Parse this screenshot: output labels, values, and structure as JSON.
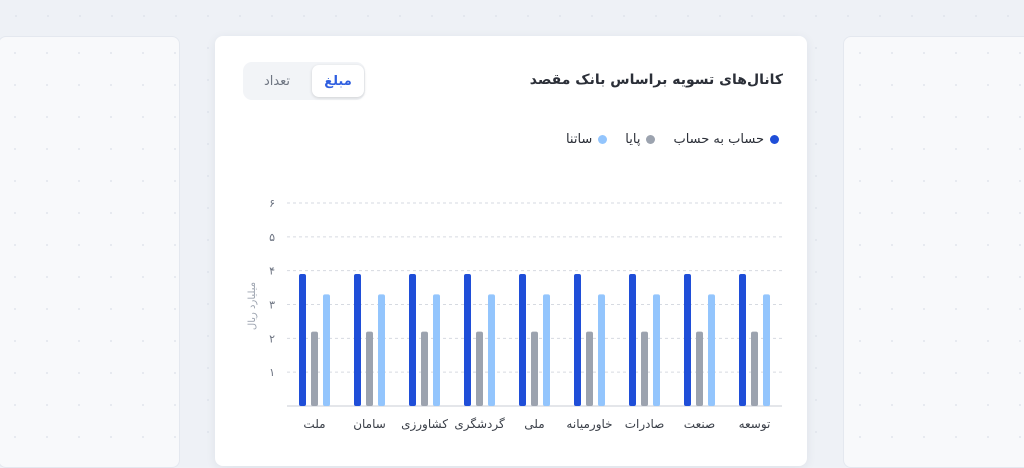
{
  "card": {
    "title": "کانال‌های تسویه براساس بانک مقصد",
    "toggle": {
      "active": "مبلغ",
      "inactive": "تعداد"
    }
  },
  "colors": {
    "hesab": "#1f4ed8",
    "paya": "#9ca3af",
    "satna": "#93c5fd"
  },
  "chart_data": {
    "type": "bar",
    "categories": [
      "توسعه",
      "صنعت",
      "صادرات",
      "خاورمیانه",
      "ملی",
      "گردشگری",
      "کشاورزی",
      "سامان",
      "ملت"
    ],
    "series": [
      {
        "name": "حساب به حساب",
        "values": [
          3.9,
          3.9,
          3.9,
          3.9,
          3.9,
          3.9,
          3.9,
          3.9,
          3.9
        ]
      },
      {
        "name": "پایا",
        "values": [
          2.2,
          2.2,
          2.2,
          2.2,
          2.2,
          2.2,
          2.2,
          2.2,
          2.2
        ]
      },
      {
        "name": "ساتنا",
        "values": [
          3.3,
          3.3,
          3.3,
          3.3,
          3.3,
          3.3,
          3.3,
          3.3,
          3.3
        ]
      }
    ],
    "yticks": [
      "۱",
      "۲",
      "۳",
      "۴",
      "۵",
      "۶"
    ],
    "ylim": [
      0,
      6
    ],
    "ylabel": "میلیارد ریال",
    "grid": true,
    "legend": "top-right"
  }
}
